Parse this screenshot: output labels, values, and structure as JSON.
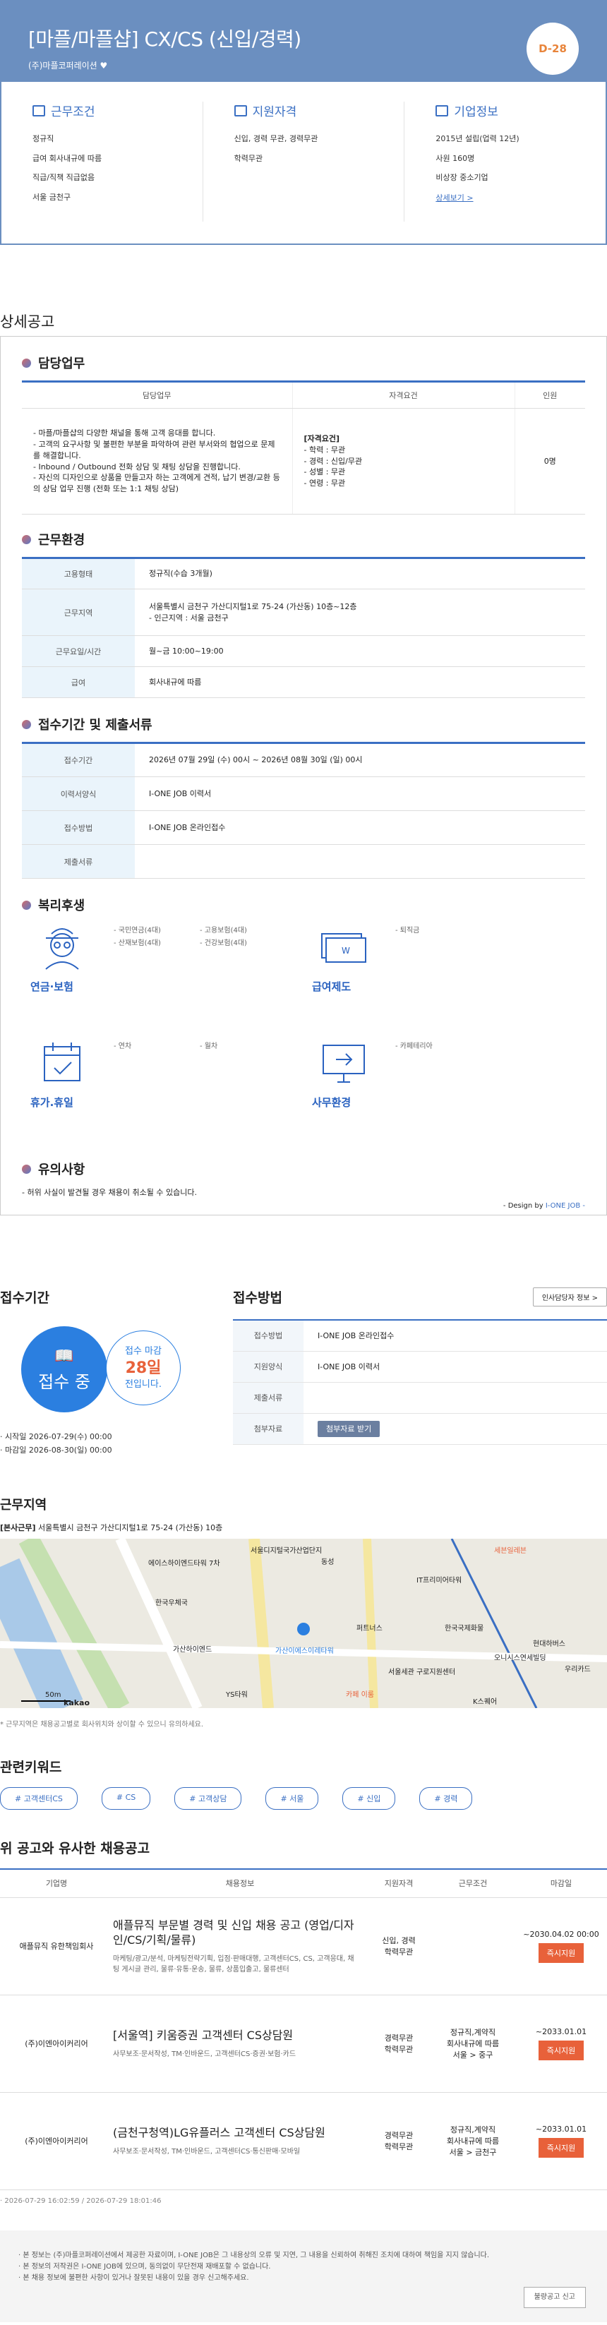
{
  "header": {
    "title": "[마플/마플샵] CX/CS (신입/경력)",
    "company": "(주)마플코퍼레이션",
    "dday": "D-28"
  },
  "summary": [
    {
      "title": "근무조건",
      "items": [
        "정규직",
        "급여 회사내규에 따름",
        "직급/직책 직급없음",
        "서울 금천구"
      ]
    },
    {
      "title": "지원자격",
      "items": [
        "신입, 경력 무관, 경력무관",
        "학력무관"
      ]
    },
    {
      "title": "기업정보",
      "items": [
        "2015년 설립(업력 12년)",
        "사원 160명",
        "비상장 중소기업"
      ],
      "link": "상세보기 >"
    }
  ],
  "detail_heading": "상세공고",
  "duty": {
    "title": "담당업무",
    "headers": [
      "담당업무",
      "자격요건",
      "인원"
    ],
    "desc": "- 마플/마플샵의 다양한 채널을 통해 고객 응대를 합니다.\n- 고객의 요구사항 및 불편한 부분을 파악하여 관련 부서와의 협업으로 문제를 해결합니다.\n- Inbound / Outbound 전화 상담 및 채팅 상담을 진행합니다.\n- 자신의 디자인으로 상품을 만들고자 하는 고객에게 견적, 납기 변경/교환 등의 상담 업무 진행 (전화 또는 1:1 채팅 상담)",
    "req_title": "[자격요건]",
    "req": "- 학력 : 무관\n- 경력 : 신입/무관\n- 성별 : 무관\n- 연령 : 무관",
    "count": "0명"
  },
  "env": {
    "title": "근무환경",
    "rows": [
      [
        "고용형태",
        "정규직(수습 3개월)"
      ],
      [
        "근무지역",
        "서울특별시 금천구 가산디지털1로 75-24 (가산동) 10층~12층\n- 인근지역 : 서울 금천구"
      ],
      [
        "근무요일/시간",
        "월~금 10:00~19:00"
      ],
      [
        "급여",
        "회사내규에 따름"
      ]
    ]
  },
  "apply": {
    "title": "접수기간 및 제출서류",
    "rows": [
      [
        "접수기간",
        "2026년 07월 29일 (수) 00시 ~ 2026년 08월 30일 (일) 00시"
      ],
      [
        "이력서양식",
        "I-ONE JOB 이력서"
      ],
      [
        "접수방법",
        "I-ONE JOB 온라인접수"
      ],
      [
        "제출서류",
        ""
      ]
    ]
  },
  "welfare": {
    "title": "복리후생",
    "items": [
      {
        "name": "연금·보험",
        "labels": [
          "- 국민연금(4대)",
          "- 고용보험(4대)",
          "- 산재보험(4대)",
          "- 건강보험(4대)"
        ]
      },
      {
        "name": "급여제도",
        "labels": [
          "- 퇴직금"
        ]
      },
      {
        "name": "휴가.휴일",
        "labels": [
          "- 연차",
          "- 월차"
        ]
      },
      {
        "name": "사무환경",
        "labels": [
          "- 카페테리아"
        ]
      }
    ]
  },
  "notice": {
    "title": "유의사항",
    "text": "- 허위 사실이 발견될 경우 채용이 취소될 수 있습니다.",
    "design": "- Design by ",
    "brand": "I-ONE JOB -"
  },
  "period": {
    "title": "접수기간",
    "status": "접수 중",
    "remain_pre": "접수 마감",
    "remain_days": "28일",
    "remain_post": "전입니다.",
    "start": "· 시작일 2026-07-29(수) 00:00",
    "end": "· 마감일 2026-08-30(일) 00:00"
  },
  "method": {
    "title": "접수방법",
    "hr_btn": "인사담당자 정보 >",
    "rows": [
      [
        "접수방법",
        "I-ONE JOB 온라인접수"
      ],
      [
        "지원양식",
        "I-ONE JOB 이력서"
      ],
      [
        "제출서류",
        ""
      ]
    ],
    "file_label": "첨부자료",
    "file_btn": "첨부자료 받기"
  },
  "location": {
    "title": "근무지역",
    "addr_b": "[본사근무]",
    "addr": " 서울특별시 금천구 가산디지털1로 75-24 (가산동) 10층",
    "scale": "50m",
    "kakao": "kakao",
    "note": "* 근무지역은 채용공고별로 회사위치와 상이할 수 있으니 유의하세요.",
    "labels": [
      "서울디지털국가산업단지",
      "동성",
      "에이스하이엔드타워 7차",
      "IT프리미어타워",
      "세븐일레븐",
      "한국우체국",
      "가산하이엔드",
      "가산이에스이레타워",
      "퍼트너스",
      "한국국제화물",
      "현대하버스",
      "YS타워",
      "카페 이룸",
      "서울세관 구로지원센터",
      "오니시스연세빌딩",
      "K스퀘어",
      "우리카드"
    ]
  },
  "keywords": {
    "title": "관련키워드",
    "items": [
      "# 고객센터CS",
      "# CS",
      "# 고객상담",
      "# 서울",
      "# 신입",
      "# 경력"
    ]
  },
  "similar": {
    "title": "위 공고와 유사한 채용공고",
    "headers": [
      "기업명",
      "채용정보",
      "지원자격",
      "근무조건",
      "마감일"
    ],
    "rows": [
      {
        "company": "애플뮤직 유한책임회사",
        "title": "애플뮤직 부문별 경력 및 신입 채용 공고 (영업/디자인/CS/기획/물류)",
        "desc": "마케팅/광고/분석, 마케팅전략기획, 입점·판매대행, 고객센터CS, CS, 고객응대, 채팅 게시글 관리, 물류·유통·운송, 물류, 상품입출고, 물류센터",
        "qual": "신입, 경력\n학력무관",
        "cond": "",
        "deadline": "~2030.04.02 00:00",
        "btn": "즉시지원"
      },
      {
        "company": "(주)이엔아이커리어",
        "title": "[서울역] 키움증권 고객센터 CS상담원",
        "desc": "사무보조·문서작성, TM·인바운드, 고객센터CS·증권·보험·카드",
        "qual": "경력무관\n학력무관",
        "cond": "정규직,계약직\n회사내규에 따름\n서울 > 중구",
        "deadline": "~2033.01.01",
        "btn": "즉시지원"
      },
      {
        "company": "(주)이엔아이커리어",
        "title": "(금천구청역)LG유플러스 고객센터 CS상담원",
        "desc": "사무보조·문서작성, TM·인바운드, 고객센터CS·통신판매·모바일",
        "qual": "경력무관\n학력무관",
        "cond": "정규직,계약직\n회사내규에 따름\n서울 > 금천구",
        "deadline": "~2033.01.01",
        "btn": "즉시지원"
      }
    ]
  },
  "dates": "· 2026-07-29 16:02:59 / 2026-07-29 18:01:46",
  "footer": {
    "lines": [
      "· 본 정보는 (주)마플코퍼레이션에서 제공한 자료이며, I-ONE JOB은 그 내용상의 오류 및 지연, 그 내용을 신뢰하여 취해진 조치에 대하여 책임을 지지 않습니다.",
      "· 본 정보의 저작권은 I-ONE JOB에 있으며, 동의없이 무단전재 재배포할 수 없습니다.",
      "· 본 채용 정보에 불편한 사항이 있거나 잘못된 내용이 있을 경우 신고해주세요."
    ],
    "report": "불량공고 신고"
  },
  "colors": {
    "accent": "#3a6fc3",
    "header": "#6b8fc0",
    "apply_btn": "#e8613a"
  }
}
